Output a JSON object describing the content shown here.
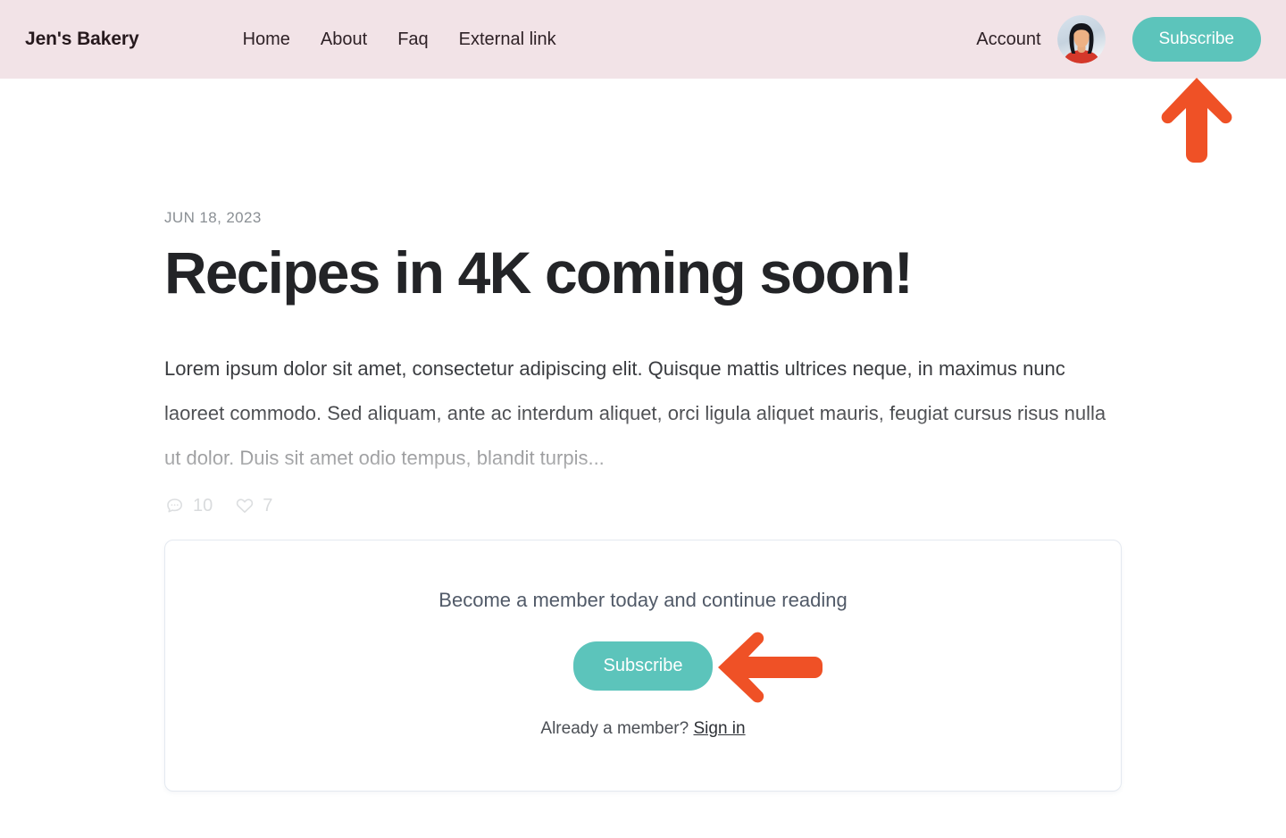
{
  "header": {
    "brand": "Jen's Bakery",
    "nav": [
      {
        "label": "Home",
        "name": "nav-link-home"
      },
      {
        "label": "About",
        "name": "nav-link-about"
      },
      {
        "label": "Faq",
        "name": "nav-link-faq"
      },
      {
        "label": "External link",
        "name": "nav-link-external"
      }
    ],
    "account_label": "Account",
    "avatar_icon": "user-avatar-illustration",
    "subscribe_label": "Subscribe",
    "background_color": "#f2e3e7",
    "accent_color": "#5cc4bb"
  },
  "article": {
    "date": "JUN 18, 2023",
    "title": "Recipes in 4K coming soon!",
    "excerpt": "Lorem ipsum dolor sit amet, consectetur adipiscing elit. Quisque mattis ultrices neque, in maximus nunc laoreet commodo. Sed aliquam, ante ac interdum aliquet, orci ligula aliquet mauris, feugiat cursus risus nulla ut dolor. Duis sit amet odio tempus, blandit turpis...",
    "meta": {
      "comment_icon": "comment-bubble-icon",
      "comment_count": "10",
      "like_icon": "heart-icon",
      "like_count": "7"
    }
  },
  "subscribe_card": {
    "heading": "Become a member today and continue reading",
    "subscribe_label": "Subscribe",
    "footnote_prefix": "Already a member?",
    "signin_label": "Sign in",
    "border_color": "#e4e9f0"
  },
  "annotations": {
    "color": "#ef5126",
    "arrow_up": "arrow-up-pointing-at-header-subscribe",
    "arrow_left": "arrow-left-pointing-at-card-subscribe"
  }
}
